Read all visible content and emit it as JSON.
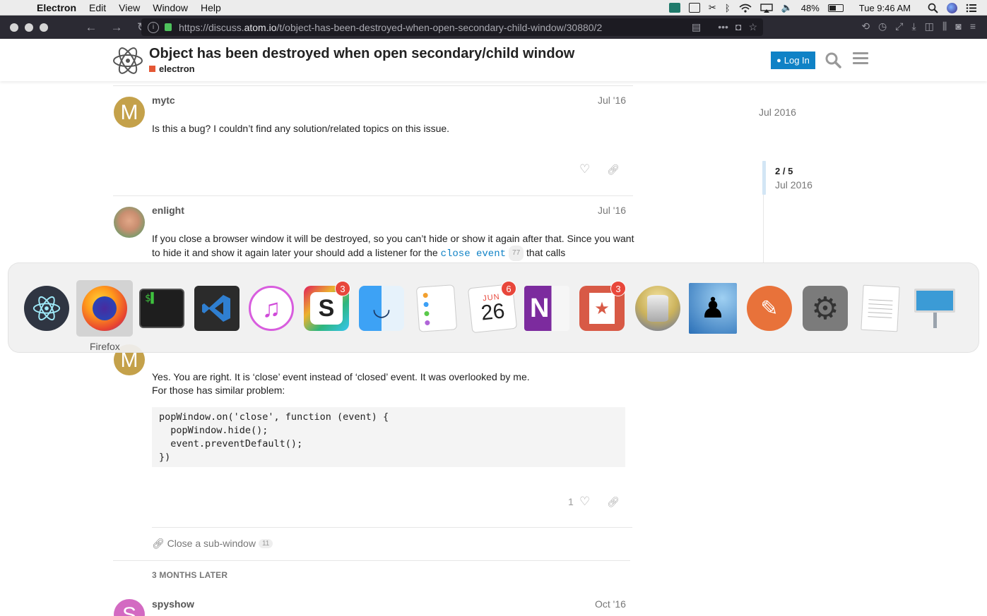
{
  "menubar": {
    "app_name": "Electron",
    "items": [
      "Edit",
      "View",
      "Window",
      "Help"
    ],
    "battery": "48%",
    "clock": "Tue 9:46 AM"
  },
  "browser": {
    "url_prefix": "https://discuss.",
    "url_domain": "atom.io",
    "url_path": "/t/object-has-been-destroyed-when-open-secondary-child-window/30880/2"
  },
  "header": {
    "title": "Object has been destroyed when open secondary/child window",
    "category": "electron",
    "category_color": "#e45735",
    "login_label": "Log In",
    "accent": "#0f82c6"
  },
  "posts": [
    {
      "username": "mytc",
      "date": "Jul '16",
      "avatar_letter": "M",
      "avatar_color": "#c4a14a",
      "body": "Is this a bug? I couldn’t find any solution/related topics on this issue."
    },
    {
      "username": "enlight",
      "date": "Jul '16",
      "body_line1": "If you close a browser window it will be destroyed, so you can’t hide or show it again after that. Since you want",
      "body_line2_pre": "to hide it and show it again later your should add a listener for the",
      "body_code": "close event",
      "body_code_count": "77",
      "body_line2_post": "that calls"
    },
    {
      "avatar_letter": "M",
      "avatar_color": "#c4a14a",
      "body_line1": "Yes. You are right. It is ‘close’ event instead of ‘closed’ event. It was overlooked by me.",
      "body_line2": "For those has similar problem:",
      "code": "popWindow.on('close', function (event) {\n  popWindow.hide();\n  event.preventDefault();\n})",
      "likes": "1"
    },
    {
      "username": "spyshow",
      "date": "Oct '16",
      "avatar_letter": "S",
      "avatar_color": "#d36ac2"
    }
  ],
  "linked_topic": {
    "label": "Close a sub-window",
    "count": "11"
  },
  "small_action": "3 MONTHS LATER",
  "timeline": {
    "top_date": "Jul 2016",
    "position": "2 / 5",
    "position_date": "Jul 2016"
  },
  "dock": {
    "hover_label": "Firefox",
    "apps": [
      {
        "name": "electron",
        "badge": ""
      },
      {
        "name": "firefox",
        "badge": ""
      },
      {
        "name": "terminal",
        "badge": ""
      },
      {
        "name": "vscode",
        "badge": ""
      },
      {
        "name": "itunes",
        "badge": ""
      },
      {
        "name": "slack",
        "badge": "3"
      },
      {
        "name": "finder",
        "badge": ""
      },
      {
        "name": "reminders",
        "badge": ""
      },
      {
        "name": "calendar",
        "badge": "6",
        "month": "JUN",
        "day": "26"
      },
      {
        "name": "onenote",
        "badge": ""
      },
      {
        "name": "wunderlist",
        "badge": "3"
      },
      {
        "name": "sequel-pro",
        "badge": ""
      },
      {
        "name": "kindle",
        "badge": ""
      },
      {
        "name": "sketchbook",
        "badge": ""
      },
      {
        "name": "system-preferences",
        "badge": ""
      },
      {
        "name": "textedit",
        "badge": ""
      },
      {
        "name": "keynote",
        "badge": ""
      }
    ]
  }
}
